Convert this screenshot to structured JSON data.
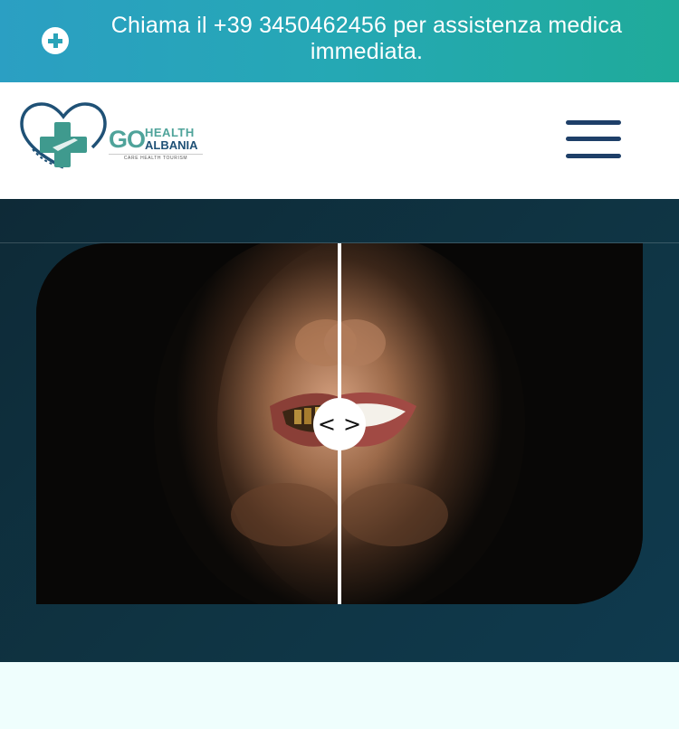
{
  "topbar": {
    "icon": "plus-circle-icon",
    "text": "Chiama il +39 3450462456 per assistenza medica immediata."
  },
  "header": {
    "logo": {
      "go": "GO",
      "health": "HEALTH",
      "albania": "ALBANIA",
      "tagline": "CARE HEALTH TOURISM"
    },
    "menu_icon": "hamburger-menu-icon"
  },
  "hero": {
    "comparison": {
      "left_image": "before-teeth-photo",
      "right_image": "after-teeth-photo",
      "handle_left": "<",
      "handle_right": ">"
    }
  },
  "colors": {
    "topbar_start": "#2b9fc3",
    "topbar_end": "#1fab9a",
    "menu": "#1e3f68",
    "hero_bg": "#0f3443",
    "logo_teal": "#4fa39a",
    "logo_navy": "#1f5176"
  }
}
